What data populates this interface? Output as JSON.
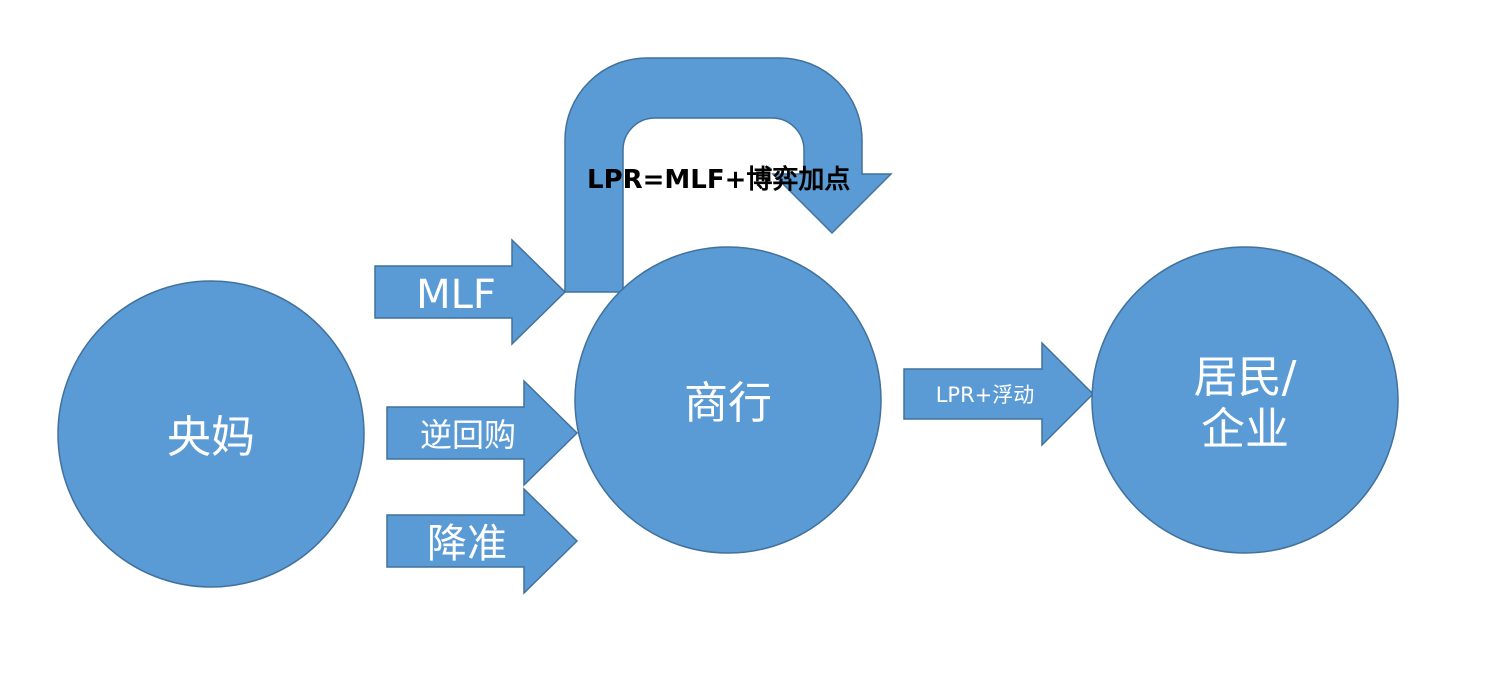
{
  "nodes": {
    "central_bank": "央妈",
    "commercial_bank": "商行",
    "household_line1": "居民/",
    "household_line2": "企业"
  },
  "arrows": {
    "mlf": "MLF",
    "reverse_repo": "逆回购",
    "rrr_cut": "降准",
    "lpr_float": "LPR+浮动"
  },
  "annotation": "LPR=MLF+博弈加点",
  "colors": {
    "shape_fill": "#5b9bd5",
    "shape_stroke": "#41719c",
    "label_light": "#ffffff",
    "label_dark": "#000000"
  }
}
